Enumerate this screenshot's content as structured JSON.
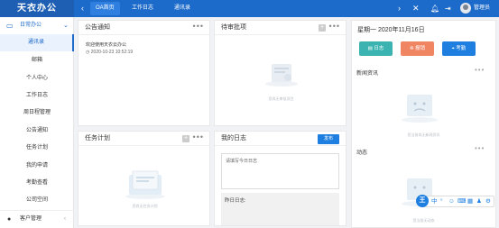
{
  "app": {
    "title": "天衣办公",
    "user": "管理员"
  },
  "topbar": {
    "tabs": [
      "OA首页",
      "工作日志",
      "通讯录"
    ]
  },
  "sidebar": {
    "group": "日常办公",
    "items": [
      "通讯录",
      "邮箱",
      "个人中心",
      "工作日志",
      "周日程管理",
      "公告通知",
      "任务计划",
      "我的申请",
      "考勤查看",
      "公司空间"
    ],
    "footer": "客户管理"
  },
  "notice": {
    "title": "公告通知",
    "item": "欢迎使用天衣云办公",
    "time": "2020-10-23 10:52:19"
  },
  "approval": {
    "title": "待审批项",
    "empty": "您尚无审批项目"
  },
  "calendar": {
    "date": "星期一 2020年11月16日",
    "buttons": [
      "日志",
      "报销",
      "考勤"
    ]
  },
  "news": {
    "title": "新闻资讯",
    "empty": "您当前尚无新闻资讯"
  },
  "activity": {
    "title": "动态",
    "empty": "您当前无动态"
  },
  "tasks": {
    "title": "任务计划",
    "empty": "您尚无任务计划"
  },
  "diary": {
    "title": "我的日志",
    "publish": "发布",
    "placeholder": "请填写今日日志",
    "yesterday": "昨日日志:"
  },
  "floatbar": {
    "brand": "王",
    "icons": [
      "中",
      "°",
      "☺",
      "⌨",
      "▦",
      "♟",
      "⚙"
    ]
  },
  "colors": {
    "primary": "#1c6ac9",
    "teal": "#3bb3b0",
    "orange": "#f08562",
    "blue": "#1e7fe0"
  }
}
